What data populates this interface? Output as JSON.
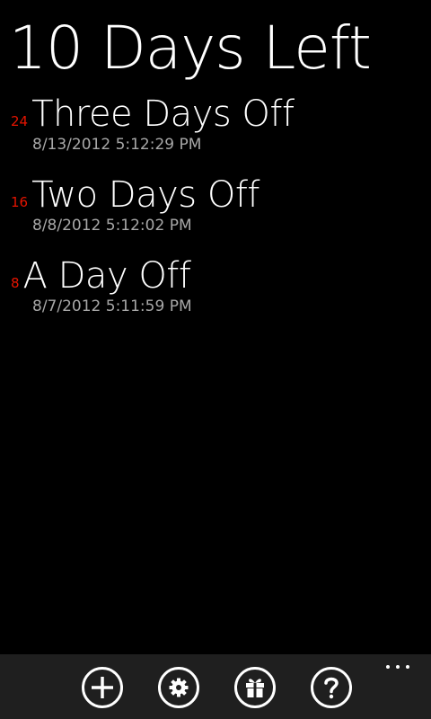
{
  "header": {
    "title": "10 Days Left"
  },
  "entries": [
    {
      "count": "24",
      "name": "Three Days Off",
      "date": "8/13/2012 5:12:29 PM"
    },
    {
      "count": "16",
      "name": "Two Days Off",
      "date": "8/8/2012 5:12:02 PM"
    },
    {
      "count": "8",
      "name": "A Day Off",
      "date": "8/7/2012 5:11:59 PM"
    }
  ],
  "app_bar": {
    "buttons": [
      {
        "icon": "add-icon"
      },
      {
        "icon": "settings-icon"
      },
      {
        "icon": "gift-icon"
      },
      {
        "icon": "help-icon"
      }
    ],
    "more_icon": "ellipsis-icon"
  },
  "colors": {
    "background": "#000000",
    "accent": "#e51400",
    "date_text": "#a8a8a8",
    "app_bar": "#1f1f1f"
  }
}
